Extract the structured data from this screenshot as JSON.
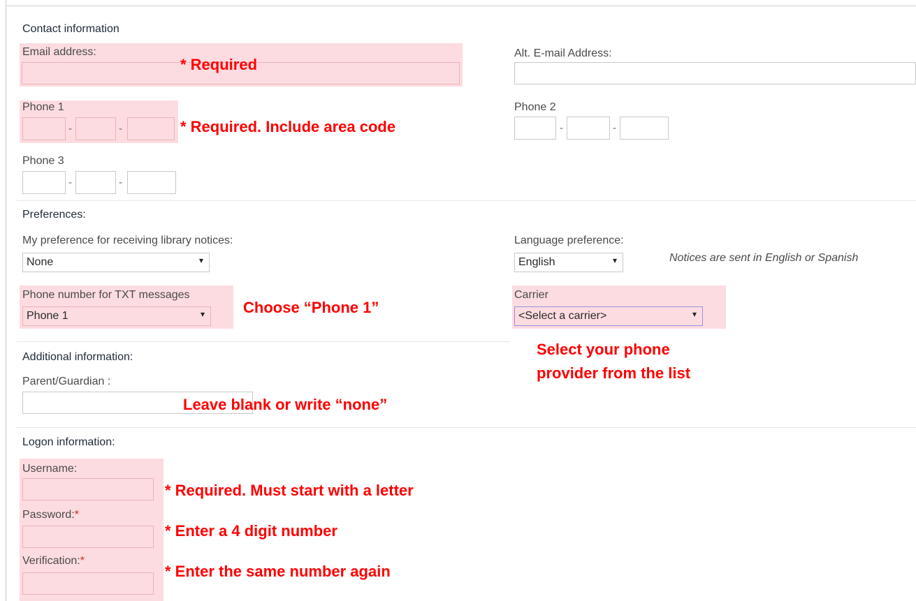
{
  "contact": {
    "section_title": "Contact information",
    "email_label": "Email address:",
    "alt_email_label": "Alt. E-mail Address:",
    "phone1_label": "Phone 1",
    "phone2_label": "Phone 2",
    "phone3_label": "Phone 3",
    "dash": "-"
  },
  "preferences": {
    "section_title": "Preferences:",
    "notice_pref_label": "My preference for receiving library notices:",
    "notice_pref_value": "None",
    "language_label": "Language preference:",
    "language_value": "English",
    "language_note": "Notices are sent in English or Spanish",
    "txt_label": "Phone number for TXT messages",
    "txt_value": "Phone 1",
    "carrier_label": "Carrier",
    "carrier_value": "<Select a carrier>"
  },
  "additional": {
    "section_title": "Additional information:",
    "guardian_label": "Parent/Guardian :"
  },
  "logon": {
    "section_title": "Logon information:",
    "username_label": "Username:",
    "password_label": "Password:",
    "verification_label": "Verification:",
    "required_star": "*"
  },
  "annotations": {
    "email": "* Required",
    "phone1": "* Required. Include area code",
    "txt": "Choose “Phone 1”",
    "carrier_line1": "Select your phone",
    "carrier_line2": "provider from the list",
    "guardian": "Leave blank or write “none”",
    "username": "* Required. Must start with a letter",
    "password": "* Enter a 4 digit number",
    "verification": "* Enter the same number again"
  },
  "icons": {
    "dropdown": "▾"
  },
  "colors": {
    "highlight": "#fcdce0",
    "annotation": "#ff0000",
    "required_star": "#e02020"
  }
}
